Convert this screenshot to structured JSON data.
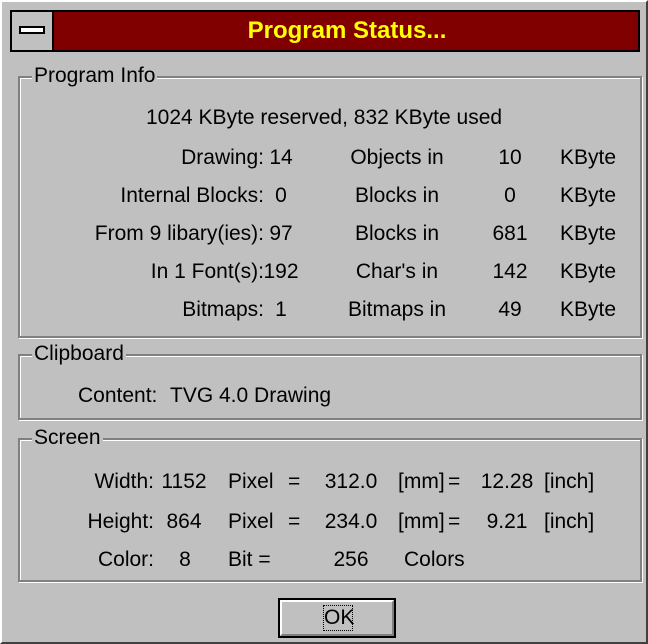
{
  "window": {
    "title": "Program Status..."
  },
  "program_info": {
    "legend": "Program Info",
    "summary": "1024  KByte reserved,  832  KByte used",
    "rows": [
      {
        "label": "Drawing:",
        "count": "14",
        "unit": "Objects in",
        "size": "10",
        "size_unit": "KByte"
      },
      {
        "label": "Internal Blocks:",
        "count": "0",
        "unit": "Blocks in",
        "size": "0",
        "size_unit": "KByte"
      },
      {
        "label": "From 9 libary(ies):",
        "count": "97",
        "unit": "Blocks in",
        "size": "681",
        "size_unit": "KByte"
      },
      {
        "label": "In 1 Font(s):",
        "count": "192",
        "unit": "Char's in",
        "size": "142",
        "size_unit": "KByte"
      },
      {
        "label": "Bitmaps:",
        "count": "1",
        "unit": "Bitmaps in",
        "size": "49",
        "size_unit": "KByte"
      }
    ]
  },
  "clipboard": {
    "legend": "Clipboard",
    "content_label": "Content:",
    "content_value": "TVG 4.0 Drawing"
  },
  "screen": {
    "legend": "Screen",
    "width": {
      "label": "Width:",
      "pixels": "1152",
      "pixel_unit": "Pixel",
      "eq1": "=",
      "mm": "312.0",
      "mm_unit": "[mm]",
      "eq2": "=",
      "inch": "12.28",
      "inch_unit": "[inch]"
    },
    "height": {
      "label": "Height:",
      "pixels": "864",
      "pixel_unit": "Pixel",
      "eq1": "=",
      "mm": "234.0",
      "mm_unit": "[mm]",
      "eq2": "=",
      "inch": "9.21",
      "inch_unit": "[inch]"
    },
    "color": {
      "label": "Color:",
      "bits": "8",
      "bit_unit": "Bit =",
      "colors": "256",
      "colors_unit": "Colors"
    }
  },
  "buttons": {
    "ok": "OK"
  },
  "colors": {
    "title_bg": "#800000",
    "title_text": "#ffff00",
    "face": "#c0c0c0"
  }
}
